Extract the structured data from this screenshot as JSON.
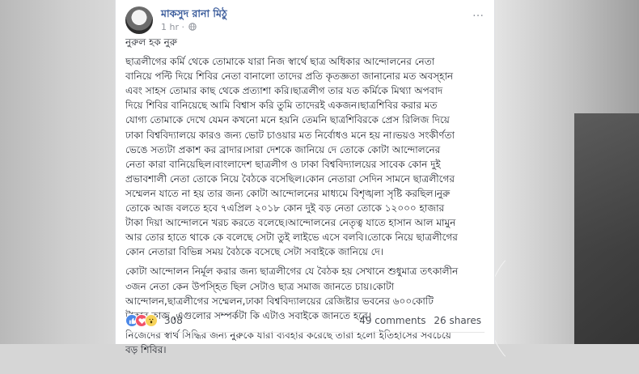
{
  "post": {
    "author": "মাকসুদ রানা মিঠু",
    "time": "1 hr ·",
    "more_icon": "…",
    "body_lines": [
      "নুরুল হক নুরু",
      "ছাত্রলীগের কর্মি থেকে তোমাকে যারা নিজ স্বার্থে ছাত্র অধিকার আন্দোলনের নেতা",
      "বানিয়ে পল্টি দিয়ে শিবির নেতা বানালো তাদের প্রতি কৃতজ্ঞতা জানানোর মত অবস্হান",
      "এবং সাহস তোমার কাছ থেকে প্রত্যাশা করি।ছাত্রলীগ তার যত কর্মিকে মিথ্যা অপবাদ",
      "দিয়ে শিবির বানিয়েছে আমি বিশ্বাস করি তুমি তাদেরই একজন।ছাত্রশিবির করার মত",
      "যোগ্য তোমাকে দেখে যেমন কখনো মনে হয়নি তেমনি ছাত্রশিবিরকে প্রেস রিলিজ দিয়ে",
      "ঢাকা বিশ্ববিদ্যালয়ে কারও জন্য ভোট চাওয়ার মত নির্বোধও মনে হয় না।ভয়ও সংকীর্ণতা",
      "ভেঙে সত্যটা প্রকাশ কর ব্রাদার।সারা দেশকে জানিয়ে দে তোকে কোটা আন্দোলনের",
      "নেতা কারা বানিয়েছিল।বাংলাদেশ ছাত্রলীগ ও ঢাকা বিশ্ববিদ্যালয়ের সাবেক কোন দুই",
      "প্রভাবশালী নেতা তোকে নিয়ে বৈঠকে বসেছিল।কোন নেতারা সেদিন সামনে ছাত্রলীগের",
      "সম্মেলন যাতে না হয় তার জন্য কোটা আন্দোলনের মাধ্যমে বিশৃঙ্খলা সৃষ্টি করছিল।নুরু",
      "তোকে আজ বলতে হবে ৭এপ্রিল ২০১৮ কোন দুই বড় নেতা তোকে ১২০০০ হাজার",
      "টাকা দিয়া আন্দোলনে খরচ করতে বলেছে।আন্দোলনের নেতৃত্ব যাতে হাসান আল মামুন",
      "আর তোর হাতে থাকে কে বলেছে সেটা তুই লাইভে এসে বলবি।তোকে নিয়ে ছাত্রলীগের",
      "কোন নেতারা বিভিন্ন সময় বৈঠকে বসেছে সেটা সবাইকে জানিয়ে দে।",
      "কোটা আন্দোলন নির্মূল করার জন্য ছাত্রলীগের যে বৈঠক হয় সেখানে শুধুমাত্র তৎকালীন",
      "৩জন নেতা কেন উপস্হিত ছিল সেটাও ছাত্র সমাজ জানতে চায়।কোটা",
      "আন্দোলন,ছাত্রলীগের সম্মেলন,ঢাকা বিশ্ববিদ্যালয়ের রেজিষ্টার ভবনের ৬০০কোটি",
      "টাকার কাজ ,এগুলোর সম্পর্কটা কি এটাও সবাইকে জানতে হবে।",
      "নিজেদের স্বার্থ সিদ্ধির জন্য নুরুকে যারা ব্যবহার করেছে তারা হলো ইতিহাসের সবচেয়ে",
      "বড় শিবির।"
    ],
    "reactions": {
      "icons": [
        "like-icon",
        "love-icon",
        "wow-icon"
      ],
      "count": "308"
    },
    "comments": "49 comments",
    "shares": "26 shares"
  }
}
